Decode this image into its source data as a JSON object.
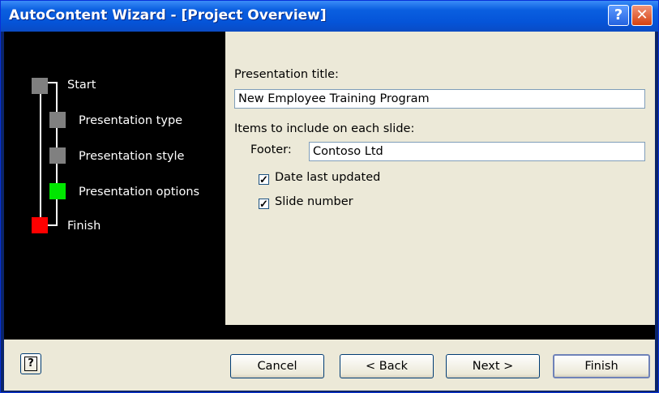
{
  "window": {
    "title": "AutoContent Wizard - [Project Overview]",
    "help_glyph": "?",
    "close_glyph": "✕"
  },
  "steps": [
    {
      "label": "Start",
      "color": "#808080"
    },
    {
      "label": "Presentation type",
      "color": "#808080"
    },
    {
      "label": "Presentation style",
      "color": "#808080"
    },
    {
      "label": "Presentation options",
      "color": "#00e600"
    },
    {
      "label": "Finish",
      "color": "#ff0000"
    }
  ],
  "form": {
    "title_label": "Presentation title:",
    "title_value": "New Employee Training Program",
    "items_label": "Items to include on each slide:",
    "footer_label": "Footer:",
    "footer_value": "Contoso Ltd",
    "date_label": "Date last updated",
    "date_checked": true,
    "slide_label": "Slide number",
    "slide_checked": true,
    "check_glyph": "✓"
  },
  "buttons": {
    "help_glyph": "?",
    "cancel": "Cancel",
    "back": "< Back",
    "next": "Next >",
    "finish": "Finish"
  }
}
